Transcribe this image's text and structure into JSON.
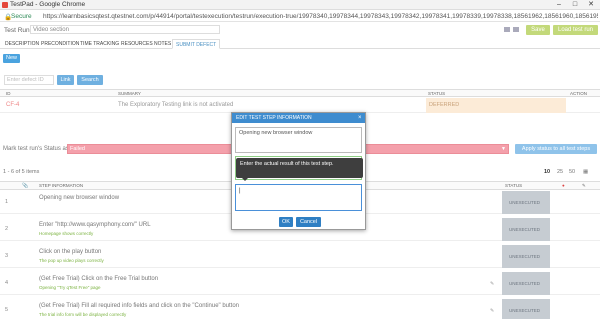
{
  "window": {
    "title": "TestPad - Google Chrome",
    "secure_label": "Secure",
    "url": "https://learnbasicsqtest.qtestnet.com/p/44914/portal/testexecution/testrun/execution-true/19978340,19978344,19978343,19978342,19978341,19978339,19978338,18561962,18561960,18561958,18561956,18561"
  },
  "toolbar": {
    "test_run_label": "Test Run",
    "test_run_value": "Video section",
    "save_label": "Save",
    "load_next_label": "Load test run"
  },
  "tabs": [
    "DESCRIPTION",
    "PRECONDITION",
    "TIME TRACKING",
    "RESOURCES",
    "NOTES",
    "SUBMIT DEFECT"
  ],
  "defects": {
    "new_label": "New",
    "link_placeholder": "Enter defect ID",
    "link_label": "Link",
    "search_label": "Search",
    "columns": {
      "id": "ID",
      "summary": "SUMMARY",
      "status": "STATUS",
      "action": "ACTION"
    },
    "row": {
      "id": "CF-4",
      "summary": "The Exploratory Testing link is not activated",
      "status": "DEFERRED"
    }
  },
  "run_status": {
    "label": "Mark test run's Status as",
    "value": "Failed",
    "apply_label": "Apply status to all test steps"
  },
  "steps_pager": {
    "items_text": "1 - 6 of 5 items",
    "page_sizes": [
      "10",
      "25",
      "50"
    ]
  },
  "steps_columns": {
    "info": "STEP INFORMATION",
    "status": "STATUS"
  },
  "steps": [
    {
      "num": "1",
      "desc": "Opening new browser window",
      "expected": "",
      "status": "UNEXECUTED"
    },
    {
      "num": "2",
      "desc": "Enter \"http://www.qasymphony.com/\" URL",
      "expected": "Homepage shows correctly",
      "status": "UNEXECUTED"
    },
    {
      "num": "3",
      "desc": "Click on the play button",
      "expected": "The pop up video plays correctly",
      "status": "UNEXECUTED"
    },
    {
      "num": "4",
      "desc": "(Get Free Trial) Click on the Free Trial button",
      "expected": "Opening \"Try qTest Free\" page",
      "status": "UNEXECUTED"
    },
    {
      "num": "5",
      "desc": "(Get Free Trial) Fill all required info fields and click on the \"Continue\" button",
      "expected": "The trial info form will be displayed correctly",
      "status": "UNEXECUTED"
    }
  ],
  "modal": {
    "title": "EDIT TEST STEP INFORMATION",
    "description": "Opening new browser window",
    "tooltip": "Enter the actual result of this test step.",
    "ok_label": "OK",
    "cancel_label": "Cancel"
  },
  "colors": {
    "primary": "#3e8ccf",
    "failed": "#f4a0ab",
    "save_green": "#c3d97a",
    "unexecuted": "#c6ccd2",
    "deferred": "#fcebd7"
  }
}
